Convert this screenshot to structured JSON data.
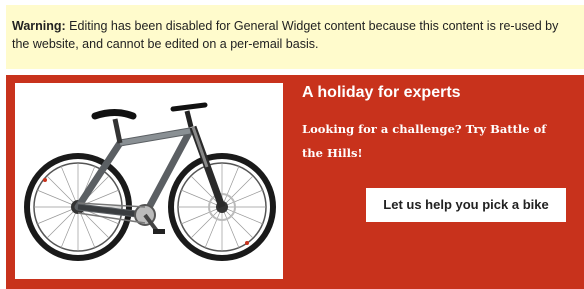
{
  "warning": {
    "label": "Warning:",
    "message": " Editing has been disabled for General Widget content because this content is re-used by the website, and cannot be edited on a per-email basis."
  },
  "promo": {
    "image_icon": "mountain-bike-photo",
    "headline": "A holiday for experts",
    "body": "Looking for a challenge? Try Battle of the Hills!",
    "cta_label": "Let us help you pick a bike",
    "background_color": "#c8321c"
  }
}
